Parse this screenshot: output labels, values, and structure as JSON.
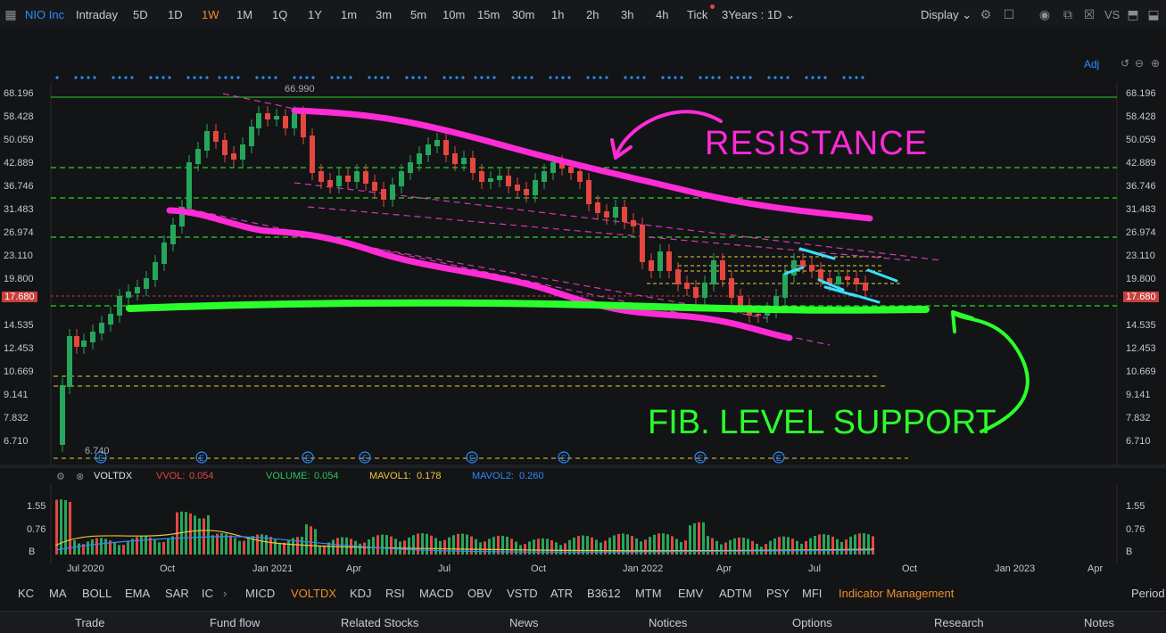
{
  "toolbar": {
    "symbol": "NIO Inc",
    "timeframes": [
      "Intraday",
      "5D",
      "1D",
      "1W",
      "1M",
      "1Q",
      "1Y",
      "1m",
      "3m",
      "5m",
      "10m",
      "15m",
      "30m",
      "1h",
      "2h",
      "3h",
      "4h",
      "Tick"
    ],
    "active_timeframe": "1W",
    "range_select": "3Years : 1D",
    "display_label": "Display",
    "vs_label": "VS",
    "adj_label": "Adj"
  },
  "price_axis": {
    "labels": [
      "68.196",
      "58.428",
      "50.059",
      "42.889",
      "36.746",
      "31.483",
      "26.974",
      "23.110",
      "19.800",
      "17.680",
      "14.535",
      "12.453",
      "10.669",
      "9.141",
      "7.832",
      "6.710"
    ],
    "current_price": "17.680",
    "high_marker": "66.990",
    "low_marker": "6.740"
  },
  "annotations": {
    "resistance": "RESISTANCE",
    "support": "FIB. LEVEL SUPPORT"
  },
  "colors": {
    "up": "#26a65b",
    "down": "#e5473f",
    "magenta": "#ff2bd6",
    "green_hl": "#2bff2b",
    "accent": "#f28c28",
    "cyan": "#38e0ff"
  },
  "indicator": {
    "name": "VOLTDX",
    "vvol_label": "VVOL:",
    "vvol_value": "0.054",
    "volume_label": "VOLUME:",
    "volume_value": "0.054",
    "mavol1_label": "MAVOL1:",
    "mavol1_value": "0.178",
    "mavol2_label": "MAVOL2:",
    "mavol2_value": "0.260",
    "axis": [
      "1.55",
      "0.76",
      "B"
    ]
  },
  "x_axis": [
    "Jul 2020",
    "Oct",
    "Jan 2021",
    "Apr",
    "Jul",
    "Oct",
    "Jan 2022",
    "Apr",
    "Jul",
    "Oct",
    "Jan 2023",
    "Apr"
  ],
  "indicator_tabs": [
    "KC",
    "MA",
    "BOLL",
    "EMA",
    "SAR",
    "IC",
    "MICD",
    "VOLTDX",
    "KDJ",
    "RSI",
    "MACD",
    "OBV",
    "VSTD",
    "ATR",
    "B3612",
    "MTM",
    "EMV",
    "ADTM",
    "PSY",
    "MFI",
    "Indicator Management"
  ],
  "active_indicator": "VOLTDX",
  "period_label": "Period",
  "bottom_nav": [
    "Trade",
    "Fund flow",
    "Related Stocks",
    "News",
    "Notices",
    "Options",
    "Research",
    "Notes"
  ]
}
